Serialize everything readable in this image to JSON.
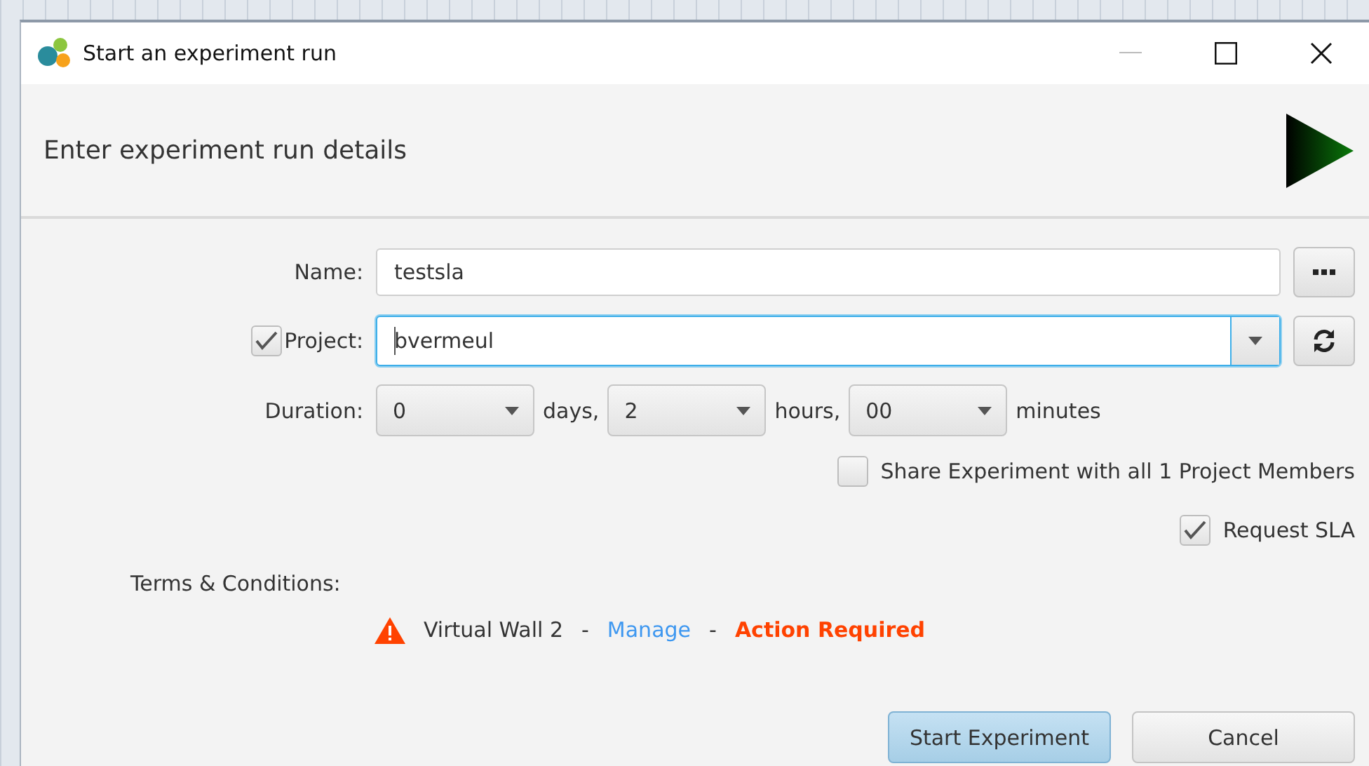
{
  "window": {
    "title": "Start an experiment run"
  },
  "header": {
    "title": "Enter experiment run details"
  },
  "form": {
    "name": {
      "label": "Name:",
      "value": "testsla"
    },
    "project": {
      "label": "Project:",
      "checked": true,
      "value": "bvermeul"
    },
    "duration": {
      "label": "Duration:",
      "fields": [
        {
          "value": "0",
          "unit": "days,"
        },
        {
          "value": "2",
          "unit": "hours,"
        },
        {
          "value": "00",
          "unit": "minutes"
        }
      ]
    },
    "options": [
      {
        "label": "Share Experiment with all 1 Project Members",
        "checked": false
      },
      {
        "label": "Request SLA",
        "checked": true
      }
    ],
    "terms": {
      "label": "Terms & Conditions:",
      "items": [
        {
          "name": "Virtual Wall 2",
          "separator_1": "-",
          "link": "Manage",
          "separator_2": "-",
          "status": "Action Required"
        }
      ]
    }
  },
  "buttons": [
    {
      "label": "Start Experiment",
      "default": true
    },
    {
      "label": "Cancel",
      "default": false
    }
  ]
}
